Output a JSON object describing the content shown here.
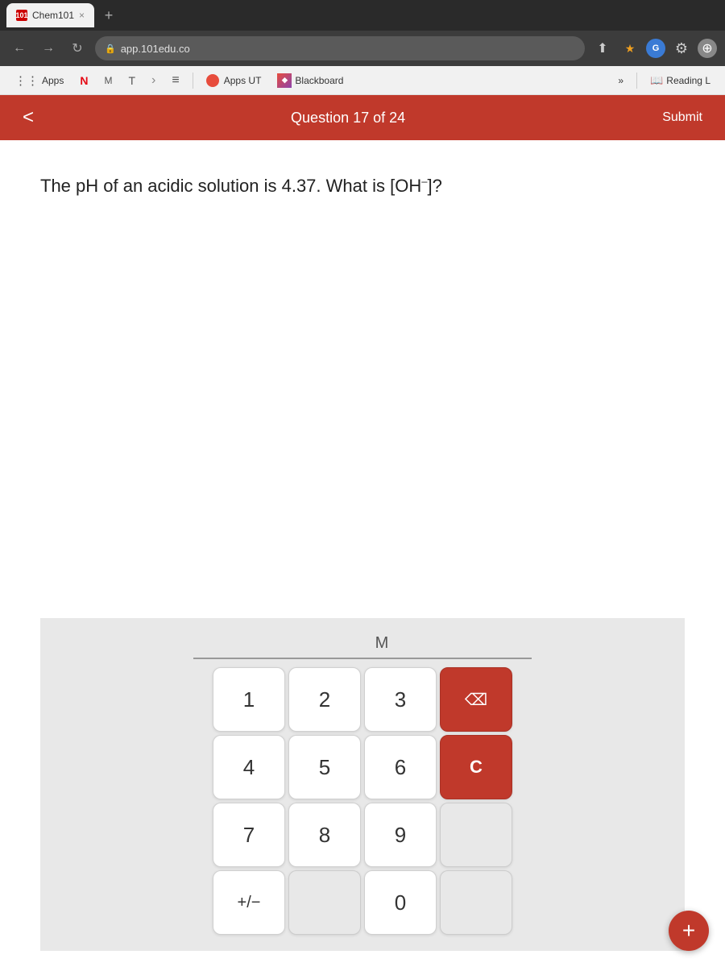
{
  "browser": {
    "tab": {
      "favicon": "101",
      "title": "Chem101",
      "close_label": "×"
    },
    "tab_new_label": "+",
    "address": {
      "lock_symbol": "🔒",
      "url": "app.101edu.co"
    },
    "actions": {
      "share": "⬆",
      "star": "★",
      "profile1_text": "G",
      "profile2_text": "⚙",
      "more": "⚙"
    }
  },
  "bookmarks": {
    "grid_label": "Apps",
    "netflix_label": "N",
    "mail_label": "M",
    "t_label": "T",
    "arrow_label": "›",
    "list_label": "≡",
    "apps_ut_label": "Apps UT",
    "apps_ut_icon": "◉",
    "blackboard_label": "Blackboard",
    "chevron_more": "»",
    "reading_label": "Reading L",
    "reading_icon": "📖"
  },
  "quiz": {
    "back_label": "<",
    "progress_label": "Question 17 of 24",
    "submit_label": "Submit",
    "question": "The pH of an acidic solution is 4.37. What is [OH",
    "question_superscript": "–",
    "question_end": "]?",
    "display_unit": "M",
    "display_value": ""
  },
  "keypad": {
    "rows": [
      [
        "1",
        "2",
        "3",
        "⌫"
      ],
      [
        "4",
        "5",
        "6",
        "C"
      ],
      [
        "7",
        "8",
        "9",
        ""
      ],
      [
        "+/-",
        "",
        "0",
        ""
      ]
    ],
    "backspace_label": "⌫",
    "clear_label": "C",
    "keys": [
      "1",
      "2",
      "3",
      "backspace",
      "4",
      "5",
      "6",
      "clear",
      "7",
      "8",
      "9",
      "empty",
      "plus-minus",
      "empty",
      "0",
      "empty"
    ]
  },
  "bottom_plus": "+"
}
